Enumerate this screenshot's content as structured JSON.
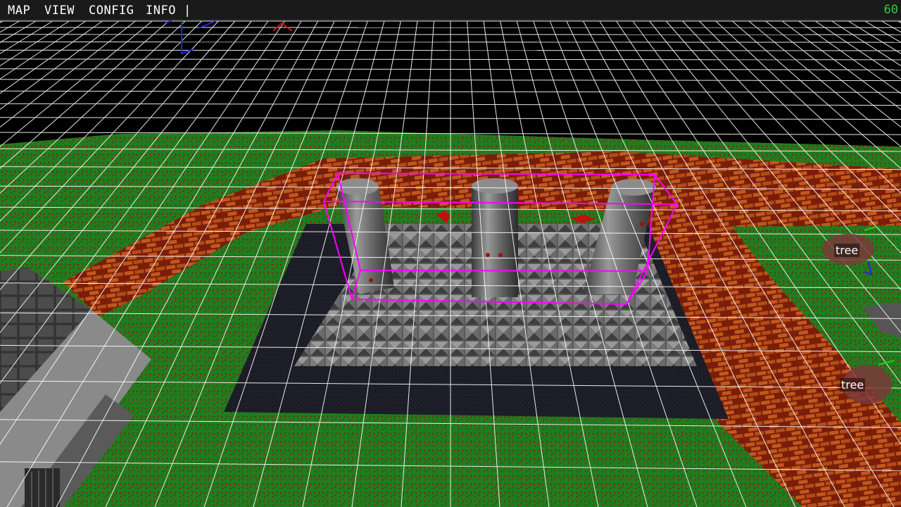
{
  "menu": {
    "map": "MAP",
    "view": "VIEW",
    "config": "CONFIG",
    "info": "INFO",
    "separator": "|"
  },
  "status": {
    "fps": "60"
  },
  "objects": [
    {
      "label": "tree"
    },
    {
      "label": "tree"
    }
  ],
  "colors": {
    "grid": "#ffffff",
    "selection": "#ff00ff",
    "grass": "#1e7a1e",
    "brick": "#8b2a0e",
    "stone": "#7a7a7a",
    "fps": "#2ecc40",
    "gizmo_blue": "#2020ff",
    "gizmo_red": "#d01010",
    "gizmo_green": "#20d020"
  }
}
